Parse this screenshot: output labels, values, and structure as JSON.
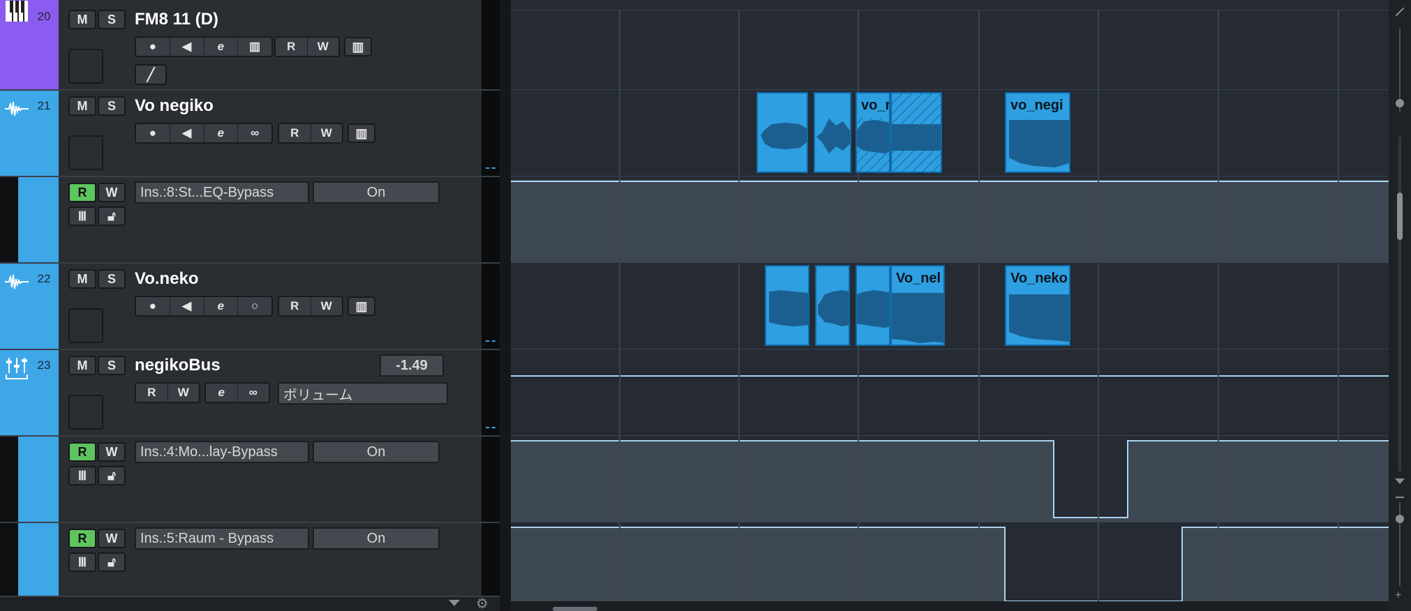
{
  "tracks": [
    {
      "number": "20",
      "name": "FM8 11 (D)",
      "type": "instrument",
      "color": "#8b5cf0",
      "mute": "M",
      "solo": "S",
      "read": "R",
      "write": "W"
    },
    {
      "number": "21",
      "name": "Vo negiko",
      "type": "audio",
      "color": "#3da7e8",
      "mute": "M",
      "solo": "S",
      "read": "R",
      "write": "W"
    },
    {
      "number": "22",
      "name": "Vo.neko",
      "type": "audio",
      "color": "#3da7e8",
      "mute": "M",
      "solo": "S",
      "read": "R",
      "write": "W"
    },
    {
      "number": "23",
      "name": "negikoBus",
      "type": "group",
      "color": "#3da7e8",
      "mute": "M",
      "solo": "S",
      "read": "R",
      "write": "W",
      "volume": "-1.49",
      "automation_param": "ボリューム"
    }
  ],
  "automation_lanes": [
    {
      "parameter": "Ins.:8:St...EQ-Bypass",
      "value": "On",
      "read": "R",
      "write": "W"
    },
    {
      "parameter": "Ins.:4:Mo...lay-Bypass",
      "value": "On",
      "read": "R",
      "write": "W"
    },
    {
      "parameter": "Ins.:5:Raum - Bypass",
      "value": "On",
      "read": "R",
      "write": "W"
    }
  ],
  "clips": {
    "vo_negiko_a": "vo_r",
    "vo_negiko_b": "vo_negi",
    "vo_neko_a": "Vo_nel",
    "vo_neko_b": "Vo_neko"
  },
  "colors": {
    "accent": "#3da7e8",
    "instrument": "#8b5cf0",
    "read_enabled": "#5ec45e",
    "clip": "#2e9fe0",
    "automation_line": "#a9d4f0"
  },
  "icons": [
    "piano-icon",
    "waveform-icon",
    "group-fader-icon",
    "record-icon",
    "speaker-icon",
    "edit-e-icon",
    "keyboard-icon",
    "link-icon",
    "pencil-icon",
    "lock-icon",
    "gear-icon",
    "dropdown-arrow-icon"
  ]
}
